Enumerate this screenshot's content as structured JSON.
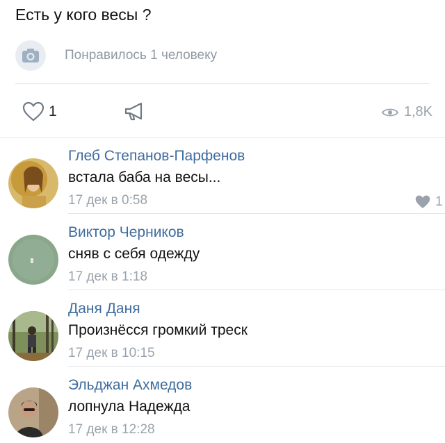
{
  "post": {
    "text": "Есть у кого весы ?",
    "likes_text": "Понравилось 1 человеку"
  },
  "actions": {
    "like_count": "1",
    "views_count": "1,8K"
  },
  "comments": [
    {
      "author": "Глеб Степанов-Парфенов",
      "text": "встала баба на весы...",
      "date": "17 дек в 0:58",
      "likes": "1"
    },
    {
      "author": "Виктор Черников",
      "text": "сняв с себя одежду",
      "date": "17 дек в 1:18"
    },
    {
      "author": "Даня Даня",
      "text": "Произнёсся громкий треск",
      "date": "17 дек в 10:15"
    },
    {
      "author": "Эльджан Ахмедов",
      "text": "лопнула Надежда",
      "date": "17 дек в 12:28"
    }
  ],
  "colors": {
    "author": "#3f6c9f",
    "muted": "#9aa3ad",
    "divider": "#e3e6ea"
  },
  "icons": [
    "camera-icon",
    "heart-icon",
    "share-megaphone-icon",
    "eye-icon"
  ]
}
